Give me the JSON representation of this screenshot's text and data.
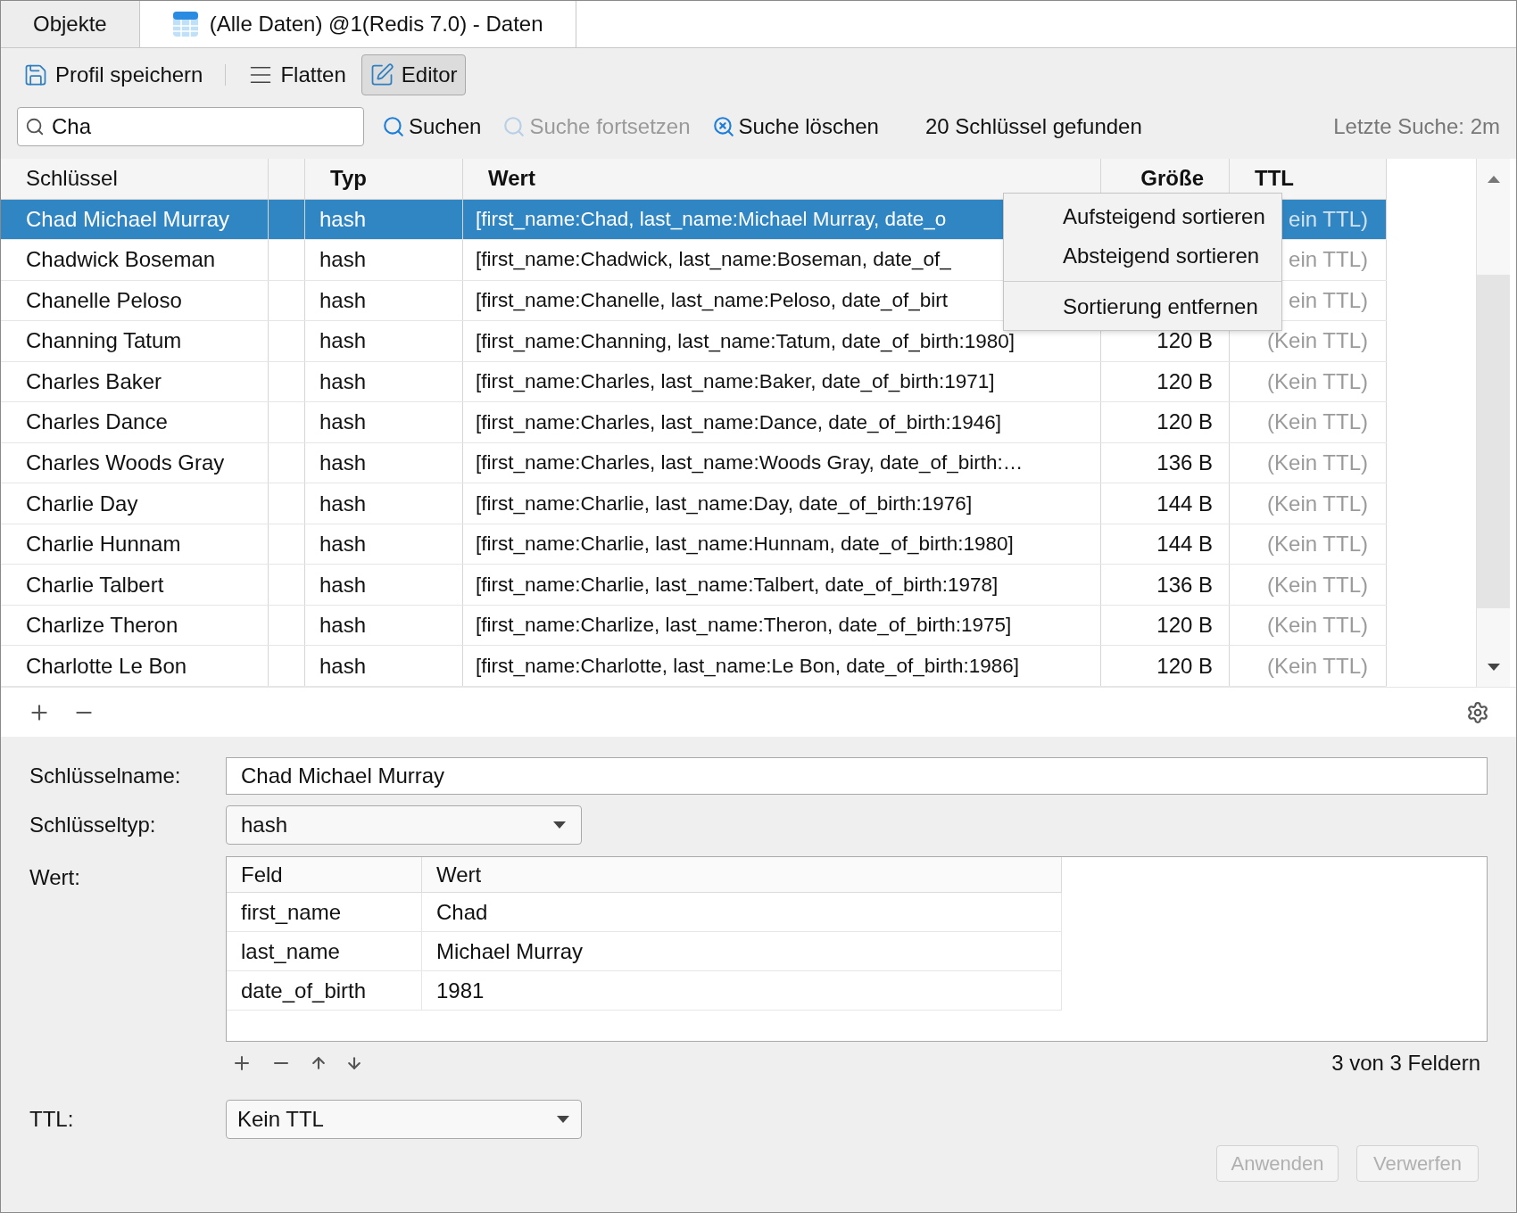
{
  "tabs": [
    {
      "label": "Objekte",
      "selected": false
    },
    {
      "label": "(Alle Daten) @1(Redis 7.0) - Daten",
      "selected": true
    }
  ],
  "toolbar": [
    {
      "label": "Profil speichern",
      "kind": "save",
      "selected": false
    },
    {
      "label": "Flatten",
      "kind": "flatten",
      "selected": false
    },
    {
      "label": "Editor",
      "kind": "editor",
      "selected": true
    }
  ],
  "search": {
    "value": "Cha",
    "actions": [
      {
        "label": "Suchen",
        "kind": "search",
        "disabled": false
      },
      {
        "label": "Suche fortsetzen",
        "kind": "continue",
        "disabled": true
      },
      {
        "label": "Suche löschen",
        "kind": "clear",
        "disabled": false
      }
    ],
    "status": "20 Schlüssel gefunden",
    "last_search": "Letzte Suche: 2m"
  },
  "table": {
    "columns": [
      "Schlüssel",
      "Typ",
      "Wert",
      "Größe",
      "TTL"
    ],
    "rows": [
      {
        "key": "Chad Michael Murray",
        "type": "hash",
        "value": "[first_name:Chad, last_name:Michael Murray, date_o",
        "ttl": "ein TTL)",
        "selected": true
      },
      {
        "key": "Chadwick Boseman",
        "type": "hash",
        "value": "[first_name:Chadwick, last_name:Boseman, date_of_",
        "ttl": "ein TTL)",
        "selected": false
      },
      {
        "key": "Chanelle Peloso",
        "type": "hash",
        "value": "[first_name:Chanelle, last_name:Peloso, date_of_birt",
        "ttl": "ein TTL)",
        "selected": false
      },
      {
        "key": "Channing Tatum",
        "type": "hash",
        "value": "[first_name:Channing, last_name:Tatum, date_of_birth:1980]",
        "size": "120 B",
        "ttl": "(Kein TTL)",
        "selected": false
      },
      {
        "key": "Charles Baker",
        "type": "hash",
        "value": "[first_name:Charles, last_name:Baker, date_of_birth:1971]",
        "size": "120 B",
        "ttl": "(Kein TTL)",
        "selected": false
      },
      {
        "key": "Charles Dance",
        "type": "hash",
        "value": "[first_name:Charles, last_name:Dance, date_of_birth:1946]",
        "size": "120 B",
        "ttl": "(Kein TTL)",
        "selected": false
      },
      {
        "key": "Charles Woods Gray",
        "type": "hash",
        "value": "[first_name:Charles, last_name:Woods Gray, date_of_birth:…",
        "size": "136 B",
        "ttl": "(Kein TTL)",
        "selected": false
      },
      {
        "key": "Charlie Day",
        "type": "hash",
        "value": "[first_name:Charlie, last_name:Day, date_of_birth:1976]",
        "size": "144 B",
        "ttl": "(Kein TTL)",
        "selected": false
      },
      {
        "key": "Charlie Hunnam",
        "type": "hash",
        "value": "[first_name:Charlie, last_name:Hunnam, date_of_birth:1980]",
        "size": "144 B",
        "ttl": "(Kein TTL)",
        "selected": false
      },
      {
        "key": "Charlie Talbert",
        "type": "hash",
        "value": "[first_name:Charlie, last_name:Talbert, date_of_birth:1978]",
        "size": "136 B",
        "ttl": "(Kein TTL)",
        "selected": false
      },
      {
        "key": "Charlize Theron",
        "type": "hash",
        "value": "[first_name:Charlize, last_name:Theron, date_of_birth:1975]",
        "size": "120 B",
        "ttl": "(Kein TTL)",
        "selected": false
      },
      {
        "key": "Charlotte Le Bon",
        "type": "hash",
        "value": "[first_name:Charlotte, last_name:Le Bon, date_of_birth:1986]",
        "size": "120 B",
        "ttl": "(Kein TTL)",
        "selected": false
      }
    ]
  },
  "context_menu": [
    {
      "kind": "item",
      "label": "Aufsteigend sortieren"
    },
    {
      "kind": "item",
      "label": "Absteigend sortieren"
    },
    {
      "kind": "separator"
    },
    {
      "kind": "item",
      "label": "Sortierung entfernen"
    }
  ],
  "editor": {
    "key_name_label": "Schlüsselname:",
    "key_name": "Chad Michael Murray",
    "key_type_label": "Schlüsseltyp:",
    "key_type": "hash",
    "value_label": "Wert:",
    "fields": {
      "columns": [
        "Feld",
        "Wert"
      ],
      "rows": [
        {
          "field": "first_name",
          "value": "Chad"
        },
        {
          "field": "last_name",
          "value": "Michael Murray"
        },
        {
          "field": "date_of_birth",
          "value": "1981"
        }
      ]
    },
    "field_count": "3 von 3 Feldern",
    "ttl_label": "TTL:",
    "ttl": "Kein TTL",
    "buttons": [
      {
        "label": "Anwenden",
        "disabled": true
      },
      {
        "label": "Verwerfen",
        "disabled": true
      }
    ]
  }
}
